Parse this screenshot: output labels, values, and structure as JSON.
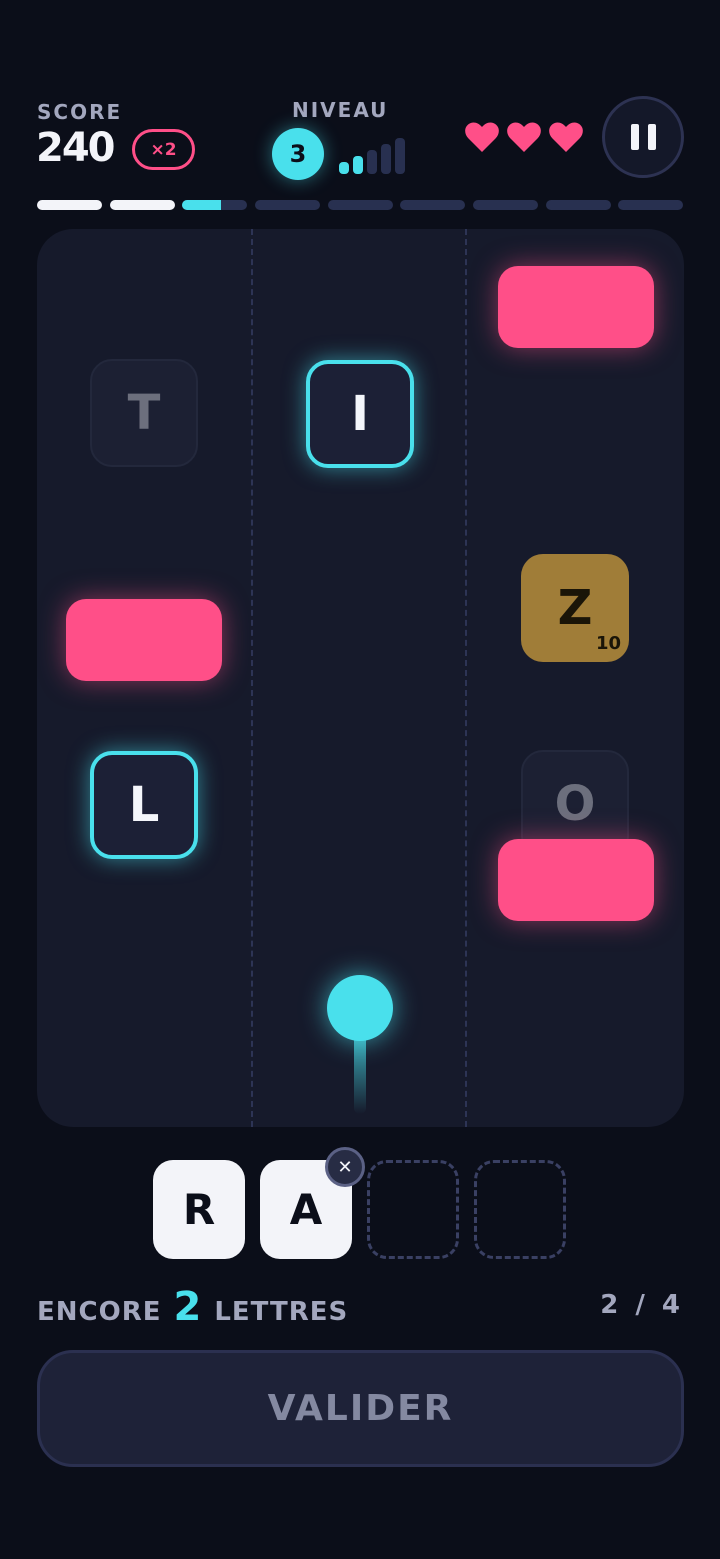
{
  "hud": {
    "score_label": "SCORE",
    "score_value": "240",
    "multiplier": "×2",
    "level_label": "NIVEAU",
    "level_number": "3",
    "signal_bars_total": 5,
    "signal_bars_active": 2,
    "lives": 3,
    "pause_icon": "pause-icon"
  },
  "progress": {
    "segments_total": 9,
    "segments_completed": 2,
    "current_segment_fill": 0.6
  },
  "board": {
    "lanes": 3,
    "tiles": [
      {
        "letter": "T",
        "lane": 1,
        "state": "faded"
      },
      {
        "letter": "I",
        "lane": 2,
        "state": "highlighted"
      },
      {
        "letter": "Z",
        "lane": 3,
        "state": "bonus",
        "points": "10"
      },
      {
        "letter": "L",
        "lane": 1,
        "state": "highlighted"
      },
      {
        "letter": "O",
        "lane": 3,
        "state": "faded"
      }
    ],
    "obstacles": 3
  },
  "word": {
    "letters": [
      "R",
      "A",
      "",
      ""
    ],
    "remove_icon": "close-icon"
  },
  "status": {
    "remaining_prefix": "ENCORE",
    "remaining_count": "2",
    "remaining_suffix": "LETTRES",
    "fraction": "2 / 4"
  },
  "actions": {
    "validate_label": "VALIDER"
  },
  "colors": {
    "background": "#0b0e19",
    "board": "#161a2b",
    "accent_cyan": "#49e0ec",
    "accent_pink": "#ff4f88",
    "bonus_gold": "#a07d38"
  }
}
